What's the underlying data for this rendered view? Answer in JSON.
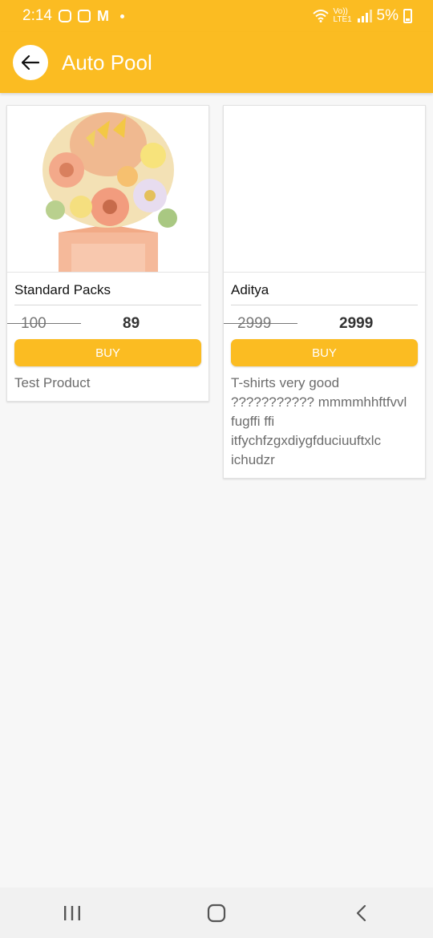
{
  "status_bar": {
    "time": "2:14",
    "network_label": "Vo)) LTE1",
    "battery": "5%"
  },
  "app_bar": {
    "title": "Auto Pool",
    "back_icon": "arrow-left-icon"
  },
  "colors": {
    "accent": "#fbbc22",
    "background": "#f7f7f7"
  },
  "products": [
    {
      "name": "Standard Packs",
      "old_price": "100",
      "price": "89",
      "buy_label": "BUY",
      "description": "Test Product",
      "image": "flower-bouquet-image"
    },
    {
      "name": "Aditya",
      "old_price": "2999",
      "price": "2999",
      "buy_label": "BUY",
      "description": "T-shirts very good ??????????? mmmmhhftfvvl fugffi ffi itfychfzgxdiygfduciuuftxlc ichudzr",
      "image": ""
    }
  ],
  "nav_bar": {
    "recents_icon": "recents-icon",
    "home_icon": "home-icon",
    "back_icon": "back-chevron-icon"
  }
}
